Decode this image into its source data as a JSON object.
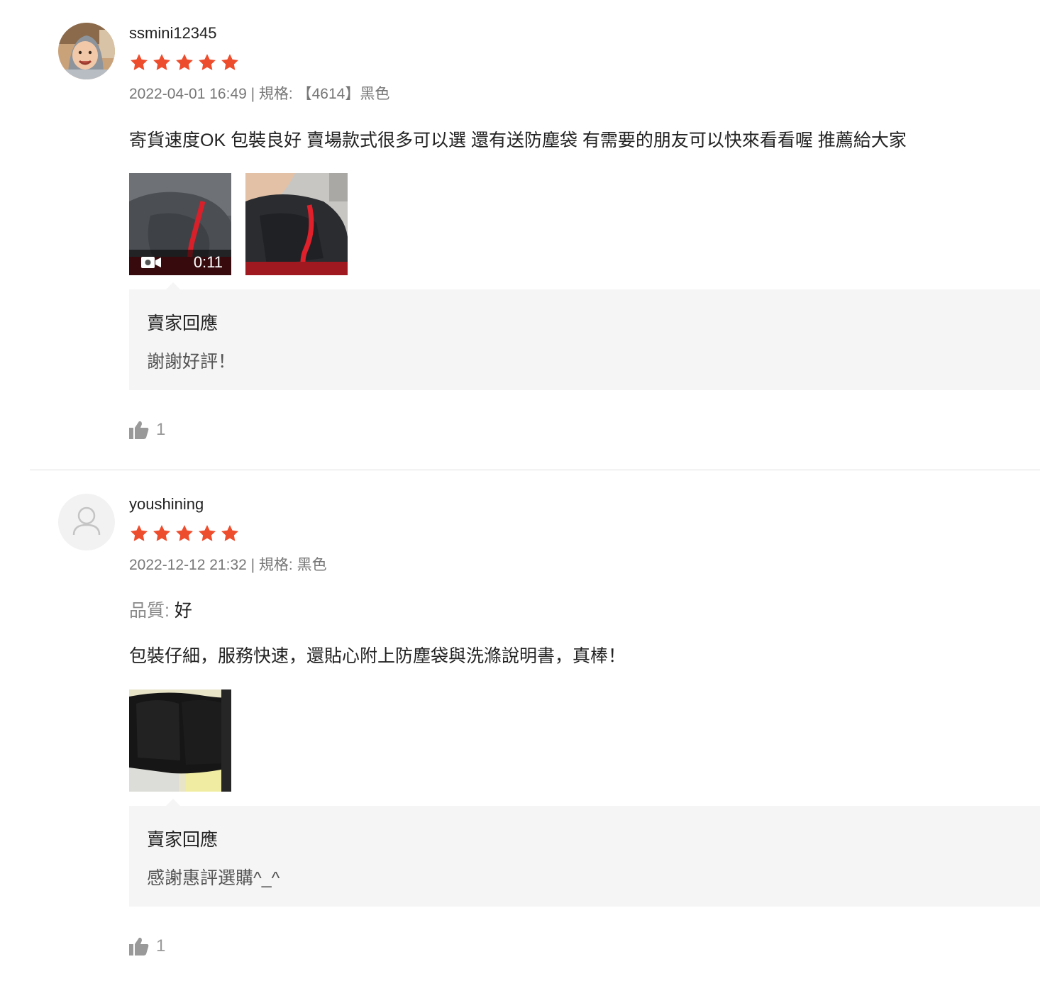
{
  "reviews": [
    {
      "username": "ssmini12345",
      "rating": 5,
      "meta": "2022-04-01 16:49 | 規格: 【4614】黑色",
      "content": "寄貨速度OK 包裝良好 賣場款式很多可以選 還有送防塵袋 有需要的朋友可以快來看看喔 推薦給大家",
      "media": [
        {
          "type": "video",
          "duration": "0:11"
        },
        {
          "type": "image"
        }
      ],
      "seller_reply": {
        "title": "賣家回應",
        "text": "謝謝好評！"
      },
      "likes": "1"
    },
    {
      "username": "youshining",
      "rating": 5,
      "meta": "2022-12-12 21:32 | 規格: 黑色",
      "quality_label": "品質:",
      "quality_value": " 好",
      "content": "包裝仔細，服務快速，還貼心附上防塵袋與洗滌說明書，真棒！",
      "media": [
        {
          "type": "image"
        }
      ],
      "seller_reply": {
        "title": "賣家回應",
        "text": "感謝惠評選購^_^"
      },
      "likes": "1"
    }
  ],
  "colors": {
    "star": "#ee4d2d",
    "reply_bg": "#f5f5f5",
    "meta_text": "#777777",
    "like_icon": "#999999"
  }
}
